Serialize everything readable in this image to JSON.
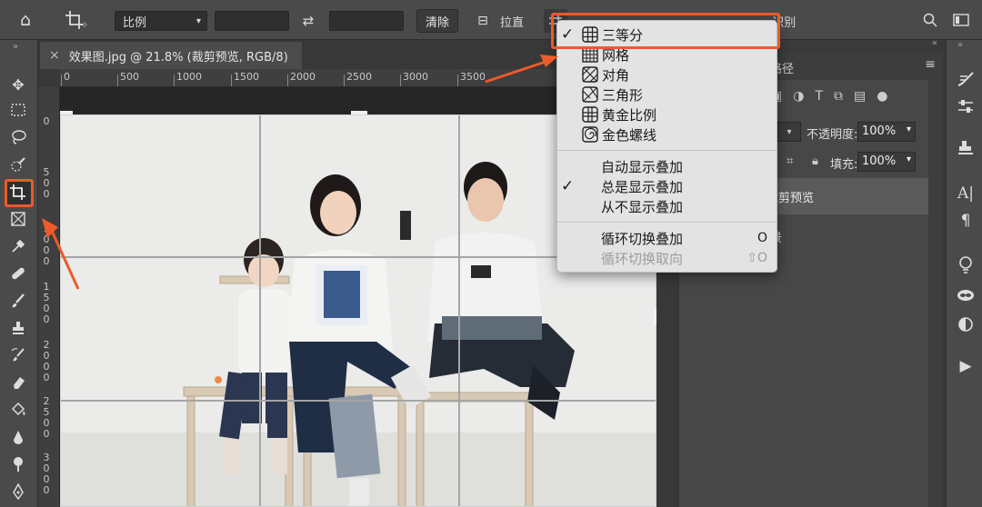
{
  "options_bar": {
    "ratio_select": "比例",
    "clear_button": "清除",
    "straighten_label": "拉直",
    "overflow_text": "...识别"
  },
  "document_tab": {
    "title": "效果图.jpg @ 21.8% (裁剪预览, RGB/8)"
  },
  "ruler": {
    "h_ticks": [
      "0",
      "500",
      "1000",
      "1500",
      "2000",
      "2500",
      "3000",
      "3500"
    ],
    "v_ticks": [
      "0",
      "5 0 0",
      "1 0 0 0",
      "1 5 0 0",
      "2 0 0 0",
      "2 5 0 0",
      "3 0 0 0"
    ]
  },
  "overlay_menu": {
    "items": [
      {
        "label": "三等分",
        "checked": true,
        "icon": "thirds-grid-icon"
      },
      {
        "label": "网格",
        "checked": false,
        "icon": "grid-icon"
      },
      {
        "label": "对角",
        "checked": false,
        "icon": "diagonal-icon"
      },
      {
        "label": "三角形",
        "checked": false,
        "icon": "triangle-icon"
      },
      {
        "label": "黄金比例",
        "checked": false,
        "icon": "golden-ratio-icon"
      },
      {
        "label": "金色螺线",
        "checked": false,
        "icon": "golden-spiral-icon"
      }
    ],
    "display_items": [
      {
        "label": "自动显示叠加",
        "checked": false
      },
      {
        "label": "总是显示叠加",
        "checked": true
      },
      {
        "label": "从不显示叠加",
        "checked": false
      }
    ],
    "cycle_items": [
      {
        "label": "循环切换叠加",
        "shortcut": "O",
        "enabled": true
      },
      {
        "label": "循环切换取向",
        "shortcut": "⇧O",
        "enabled": false
      }
    ]
  },
  "panels": {
    "paths_tab": "路径",
    "opacity_label": "不透明度:",
    "opacity_value": "100%",
    "fill_label": "填充:",
    "fill_value": "100%",
    "layer_name": "裁剪预览",
    "layer_name_2": "景"
  },
  "colors": {
    "highlight": "#ee5a2a"
  }
}
